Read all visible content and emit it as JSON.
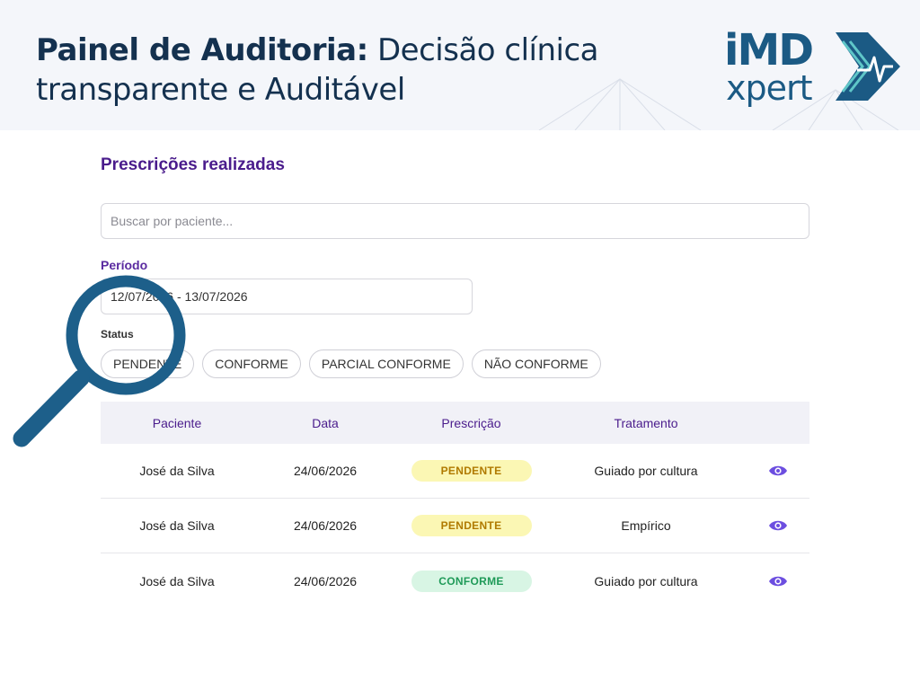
{
  "banner": {
    "title_bold": "Painel de Auditoria:",
    "title_rest": " Decisão clínica transparente e Auditável",
    "logo_top": "iMD",
    "logo_bottom": "xpert"
  },
  "panel": {
    "title": "Prescrições realizadas",
    "search_placeholder": "Buscar por paciente...",
    "period_label": "Período",
    "period_value": "12/07/2026 - 13/07/2026",
    "status_label": "Status",
    "status_chips": [
      "PENDENTE",
      "CONFORME",
      "PARCIAL CONFORME",
      "NÃO CONFORME"
    ]
  },
  "table": {
    "headers": [
      "Paciente",
      "Data",
      "Prescrição",
      "Tratamento"
    ],
    "rows": [
      {
        "paciente": "José da Silva",
        "data": "24/06/2026",
        "prescricao": "PENDENTE",
        "tratamento": "Guiado por cultura"
      },
      {
        "paciente": "José da Silva",
        "data": "24/06/2026",
        "prescricao": "PENDENTE",
        "tratamento": "Empírico"
      },
      {
        "paciente": "José da Silva",
        "data": "24/06/2026",
        "prescricao": "CONFORME",
        "tratamento": "Guiado por cultura"
      }
    ]
  },
  "colors": {
    "brand": "#1b5a84",
    "accent": "#4a1c8c",
    "pending": "#fbf7b4",
    "compliant": "#d8f5e4",
    "eye": "#6c4ee0"
  },
  "icons": {
    "magnifier": "magnifier-icon",
    "view": "eye-icon",
    "logo_mark": "ecg-pulse-icon"
  }
}
